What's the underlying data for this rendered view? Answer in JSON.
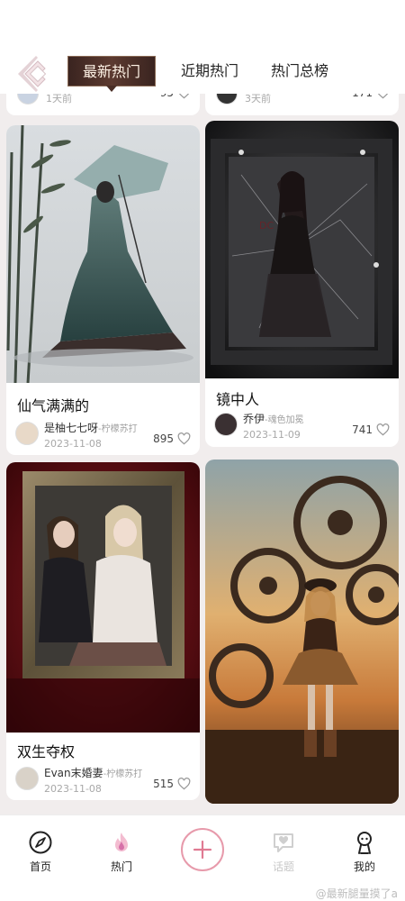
{
  "tabs": [
    {
      "label": "最新热门",
      "active": true
    },
    {
      "label": "近期热门",
      "active": false
    },
    {
      "label": "热门总榜",
      "active": false
    }
  ],
  "peek": {
    "left": {
      "time": "1天前",
      "likes": "95"
    },
    "right": {
      "time": "3天前",
      "likes": "171"
    }
  },
  "cards": [
    {
      "title": "仙气满满的",
      "author": "是柚七七呀",
      "source": "-柠檬苏打",
      "date": "2023-11-08",
      "likes": "895",
      "image": "painting of a woman in a teal hanfu holding a paper umbrella among bamboo"
    },
    {
      "title": "镜中人",
      "author": "乔伊",
      "source": "-魂色加冕",
      "date": "2023-11-09",
      "likes": "741",
      "image": "gothic woman in black lace dress inside a shattered ornate mirror frame"
    },
    {
      "title": "双生夺权",
      "author": "Evan末婚妻",
      "source": "-柠檬苏打",
      "date": "2023-11-08",
      "likes": "515",
      "image": "two women in an ornate golden frame on dark red background"
    },
    {
      "image": "steampunk girl standing among giant gears at sunset"
    }
  ],
  "nav": [
    {
      "label": "首页",
      "icon": "compass-icon"
    },
    {
      "label": "热门",
      "icon": "flame-icon"
    },
    {
      "label": "",
      "icon": "plus-icon"
    },
    {
      "label": "话题",
      "icon": "chat-heart-icon"
    },
    {
      "label": "我的",
      "icon": "person-icon"
    }
  ],
  "watermark": "@最新腿量摸了a",
  "colors": {
    "accent": "#e79aab",
    "tab_active_bg": "#4a2e26",
    "background": "#f1eded"
  }
}
